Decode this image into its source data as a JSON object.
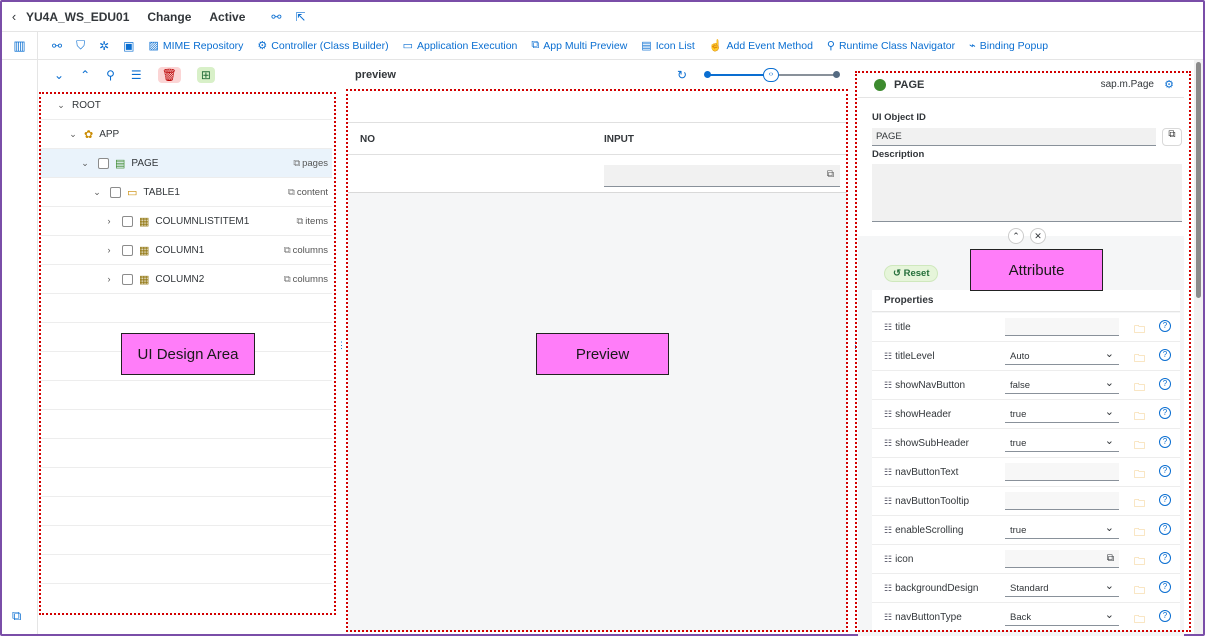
{
  "header": {
    "back_icon": "chevron-left",
    "app_name": "YU4A_WS_EDU01",
    "mode": "Change",
    "status": "Active"
  },
  "toolbar": {
    "items": [
      {
        "icon": "chart-icon",
        "label": "MIME Repository"
      },
      {
        "icon": "gear-icon",
        "label": "Controller (Class Builder)"
      },
      {
        "icon": "run-icon",
        "label": "Application Execution"
      },
      {
        "icon": "preview-icon",
        "label": "App Multi Preview"
      },
      {
        "icon": "list-icon",
        "label": "Icon List"
      },
      {
        "icon": "event-icon",
        "label": "Add Event Method"
      },
      {
        "icon": "navigator-icon",
        "label": "Runtime Class Navigator"
      },
      {
        "icon": "link-icon",
        "label": "Binding Popup"
      }
    ]
  },
  "tree": {
    "rows": [
      {
        "name": "ROOT",
        "aggregation": ""
      },
      {
        "name": "APP",
        "aggregation": ""
      },
      {
        "name": "PAGE",
        "aggregation": "pages"
      },
      {
        "name": "TABLE1",
        "aggregation": "content"
      },
      {
        "name": "COLUMNLISTITEM1",
        "aggregation": "items"
      },
      {
        "name": "COLUMN1",
        "aggregation": "columns"
      },
      {
        "name": "COLUMN2",
        "aggregation": "columns"
      }
    ]
  },
  "labels": {
    "design_area": "UI Design Area",
    "preview": "Preview",
    "attribute": "Attribute"
  },
  "preview": {
    "title": "preview",
    "columns": [
      "NO",
      "INPUT"
    ]
  },
  "attributes": {
    "object_name": "PAGE",
    "class_name": "sap.m.Page",
    "ui_object_id_label": "UI Object ID",
    "ui_object_id": "PAGE",
    "description_label": "Description",
    "reset_label": "Reset",
    "properties_label": "Properties",
    "properties": [
      {
        "name": "title",
        "value": ""
      },
      {
        "name": "titleLevel",
        "value": "Auto"
      },
      {
        "name": "showNavButton",
        "value": "false"
      },
      {
        "name": "showHeader",
        "value": "true"
      },
      {
        "name": "showSubHeader",
        "value": "true"
      },
      {
        "name": "navButtonText",
        "value": ""
      },
      {
        "name": "navButtonTooltip",
        "value": ""
      },
      {
        "name": "enableScrolling",
        "value": "true"
      },
      {
        "name": "icon",
        "value": ""
      },
      {
        "name": "backgroundDesign",
        "value": "Standard"
      },
      {
        "name": "navButtonType",
        "value": "Back"
      }
    ]
  },
  "colors": {
    "accent": "#0a6ed1",
    "frame": "#7a4ea8",
    "highlight_label": "#ff7df9",
    "dotted_border": "#d20000"
  }
}
